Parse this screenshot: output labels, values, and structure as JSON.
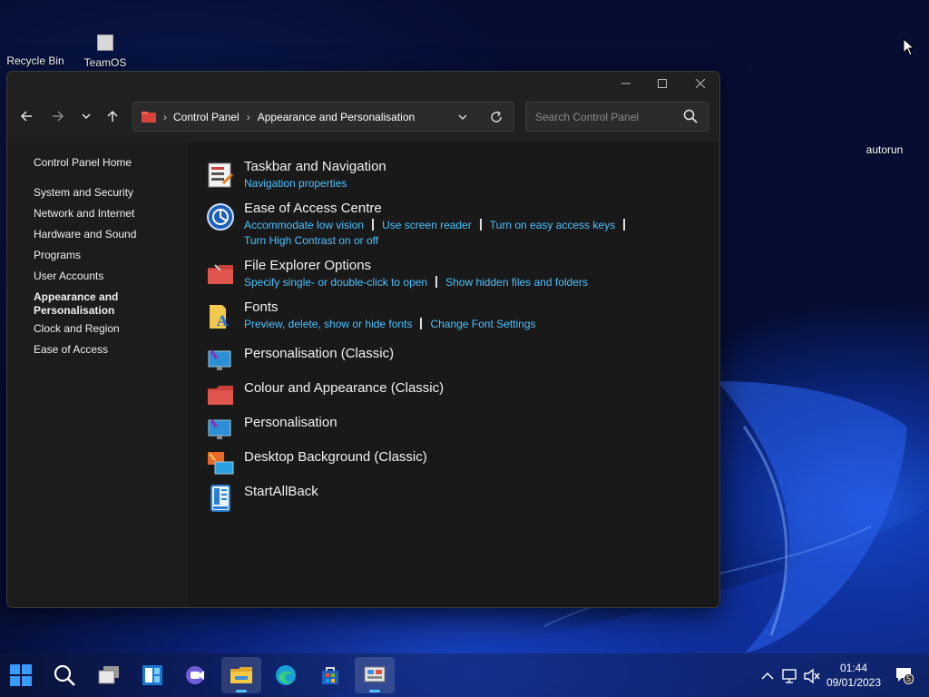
{
  "desktop": {
    "icons": [
      {
        "label": "Recycle Bin"
      },
      {
        "label": "TeamOS"
      }
    ],
    "autorun_label": "autorun"
  },
  "window": {
    "address": {
      "crumbs": [
        "Control Panel",
        "Appearance and Personalisation"
      ]
    },
    "search": {
      "placeholder": "Search Control Panel"
    },
    "sidebar": {
      "items": [
        {
          "label": "Control Panel Home"
        },
        {
          "label": "System and Security"
        },
        {
          "label": "Network and Internet"
        },
        {
          "label": "Hardware and Sound"
        },
        {
          "label": "Programs"
        },
        {
          "label": "User Accounts"
        },
        {
          "label": "Appearance and Personalisation",
          "active": true
        },
        {
          "label": "Clock and Region"
        },
        {
          "label": "Ease of Access"
        }
      ]
    },
    "categories": [
      {
        "title": "Taskbar and Navigation",
        "links": [
          "Navigation properties"
        ]
      },
      {
        "title": "Ease of Access Centre",
        "links": [
          "Accommodate low vision",
          "Use screen reader",
          "Turn on easy access keys",
          "Turn High Contrast on or off"
        ]
      },
      {
        "title": "File Explorer Options",
        "links": [
          "Specify single- or double-click to open",
          "Show hidden files and folders"
        ]
      },
      {
        "title": "Fonts",
        "links": [
          "Preview, delete, show or hide fonts",
          "Change Font Settings"
        ]
      },
      {
        "title": "Personalisation (Classic)",
        "links": []
      },
      {
        "title": "Colour and Appearance (Classic)",
        "links": []
      },
      {
        "title": "Personalisation",
        "links": []
      },
      {
        "title": "Desktop Background (Classic)",
        "links": []
      },
      {
        "title": "StartAllBack",
        "links": []
      }
    ]
  },
  "taskbar": {
    "clock": {
      "time": "01:44",
      "date": "09/01/2023"
    },
    "notification_count": "5"
  },
  "colors": {
    "link": "#4cc2ff",
    "window_bg": "#202020",
    "taskbar_active": "#2d3350"
  }
}
